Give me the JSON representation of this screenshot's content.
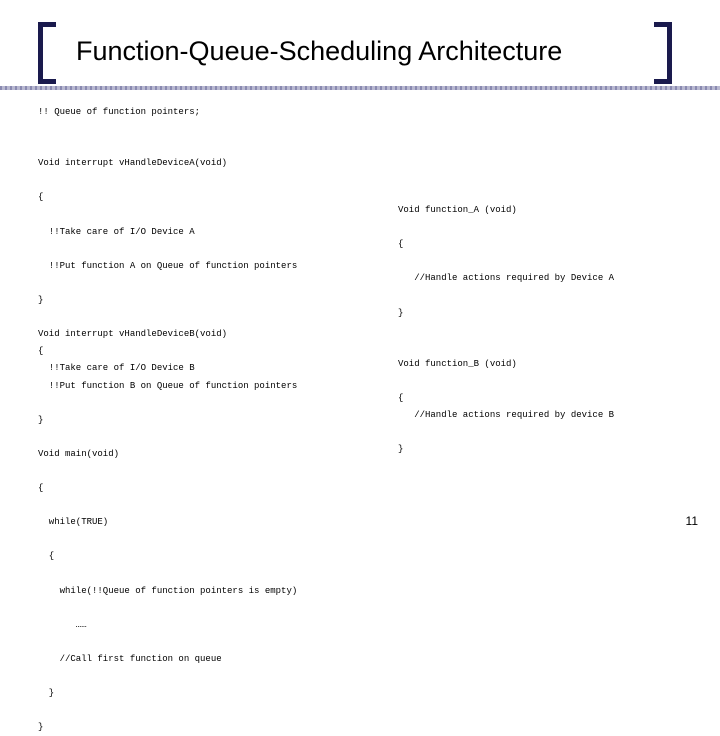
{
  "title": "Function-Queue-Scheduling Architecture",
  "page_number": "11",
  "code_left": "!! Queue of function pointers;\n\n\nVoid interrupt vHandleDeviceA(void)\n\n{\n\n  !!Take care of I/O Device A\n\n  !!Put function A on Queue of function pointers\n\n}\n\nVoid interrupt vHandleDeviceB(void)\n{\n  !!Take care of I/O Device B\n  !!Put function B on Queue of function pointers\n\n}\n\nVoid main(void)\n\n{\n\n  while(TRUE)\n\n  {\n\n    while(!!Queue of function pointers is empty)\n\n       ……\n\n    //Call first function on queue\n\n  }\n\n}",
  "code_right": "Void function_A (void)\n\n{\n\n   //Handle actions required by Device A\n\n}\n\n\nVoid function_B (void)\n\n{\n   //Handle actions required by device B\n\n}"
}
